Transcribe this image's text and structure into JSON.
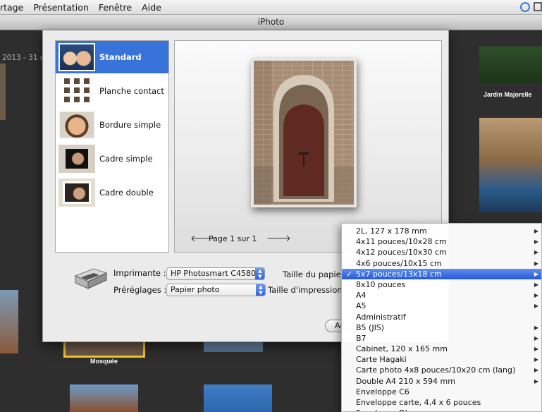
{
  "menubar": {
    "items": [
      "rtage",
      "Présentation",
      "Fenêtre",
      "Aide"
    ]
  },
  "window": {
    "title": "iPhoto"
  },
  "library": {
    "date_range": "2013 - 31 d",
    "captions": {
      "jardin": "Jardin Majorelle",
      "mosquee": "Mosquée"
    }
  },
  "themes": [
    {
      "label": "Standard",
      "selected": true
    },
    {
      "label": "Planche contact",
      "selected": false
    },
    {
      "label": "Bordure simple",
      "selected": false
    },
    {
      "label": "Cadre simple",
      "selected": false
    },
    {
      "label": "Cadre double",
      "selected": false
    }
  ],
  "preview": {
    "page_text": "Page 1 sur 1"
  },
  "form": {
    "printer_label": "Imprimante :",
    "printer_value": "HP Photosmart C4580",
    "presets_label": "Préréglages :",
    "presets_value": "Papier photo",
    "paper_size_label": "Taille du papier",
    "print_size_label": "Taille d'impression",
    "partial_button": "Ar"
  },
  "paper_menu": {
    "selected_index": 4,
    "items": [
      {
        "label": "2L, 127 x 178 mm",
        "submenu": true
      },
      {
        "label": "4x11 pouces/10x28 cm",
        "submenu": true
      },
      {
        "label": "4x12 pouces/10x30 cm",
        "submenu": true
      },
      {
        "label": "4x6 pouces/10x15 cm",
        "submenu": true
      },
      {
        "label": "5x7 pouces/13x18 cm",
        "submenu": true
      },
      {
        "label": "8x10 pouces",
        "submenu": true
      },
      {
        "label": "A4",
        "submenu": true
      },
      {
        "label": "A5",
        "submenu": true
      },
      {
        "label": "Administratif",
        "submenu": false
      },
      {
        "label": "B5 (JIS)",
        "submenu": true
      },
      {
        "label": "B7",
        "submenu": true
      },
      {
        "label": "Cabinet, 120 x 165 mm",
        "submenu": true
      },
      {
        "label": "Carte Hagaki",
        "submenu": true
      },
      {
        "label": "Carte photo 4x8 pouces/10x20 cm (lang)",
        "submenu": true
      },
      {
        "label": "Double A4 210 x 594 mm",
        "submenu": true
      },
      {
        "label": "Enveloppe C6",
        "submenu": false
      },
      {
        "label": "Enveloppe carte, 4,4 x 6 pouces",
        "submenu": false
      },
      {
        "label": "Enveloppe DL",
        "submenu": false
      }
    ],
    "check_glyph": "✓"
  },
  "icons": {
    "menubar_right": [
      "sync-icon",
      "display-icon"
    ],
    "nav_prev": "arrow-left-icon",
    "nav_next": "arrow-right-icon",
    "submenu": "triangle-right-icon"
  },
  "colors": {
    "selection": "#3873d9",
    "menu_highlight": "#2659d6",
    "library_bg": "#2e2e2e"
  }
}
